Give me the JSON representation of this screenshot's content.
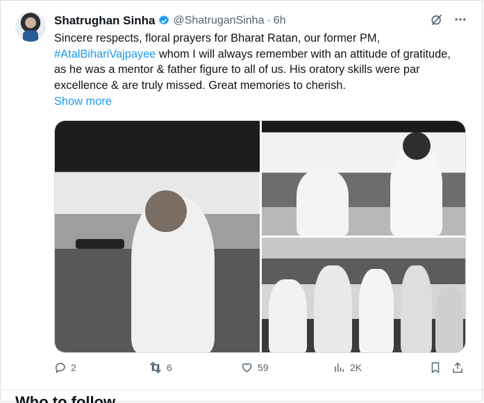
{
  "tweet": {
    "author_name": "Shatrughan Sinha",
    "author_handle": "@ShatruganSinha",
    "separator": "·",
    "time": "6h",
    "text_before": "Sincere respects, floral prayers for Bharat Ratan, our former PM, ",
    "hashtag": "#AtalBihariVajpayee",
    "text_after": " whom I will always remember with an attitude of gratitude, as he was a mentor & father figure to all of us. His oratory skills were par excellence & are truly missed. Great memories to cherish.",
    "show_more": "Show more",
    "verified_color": "#1d9bf0"
  },
  "actions": {
    "reply_count": "2",
    "retweet_count": "6",
    "like_count": "59",
    "views_count": "2K"
  },
  "icons": {
    "grok": "grok-icon",
    "more": "more-icon",
    "reply": "reply-icon",
    "retweet": "retweet-icon",
    "like": "heart-icon",
    "views": "views-icon",
    "bookmark": "bookmark-icon",
    "share": "share-icon"
  },
  "next_section": {
    "title": "Who to follow"
  }
}
